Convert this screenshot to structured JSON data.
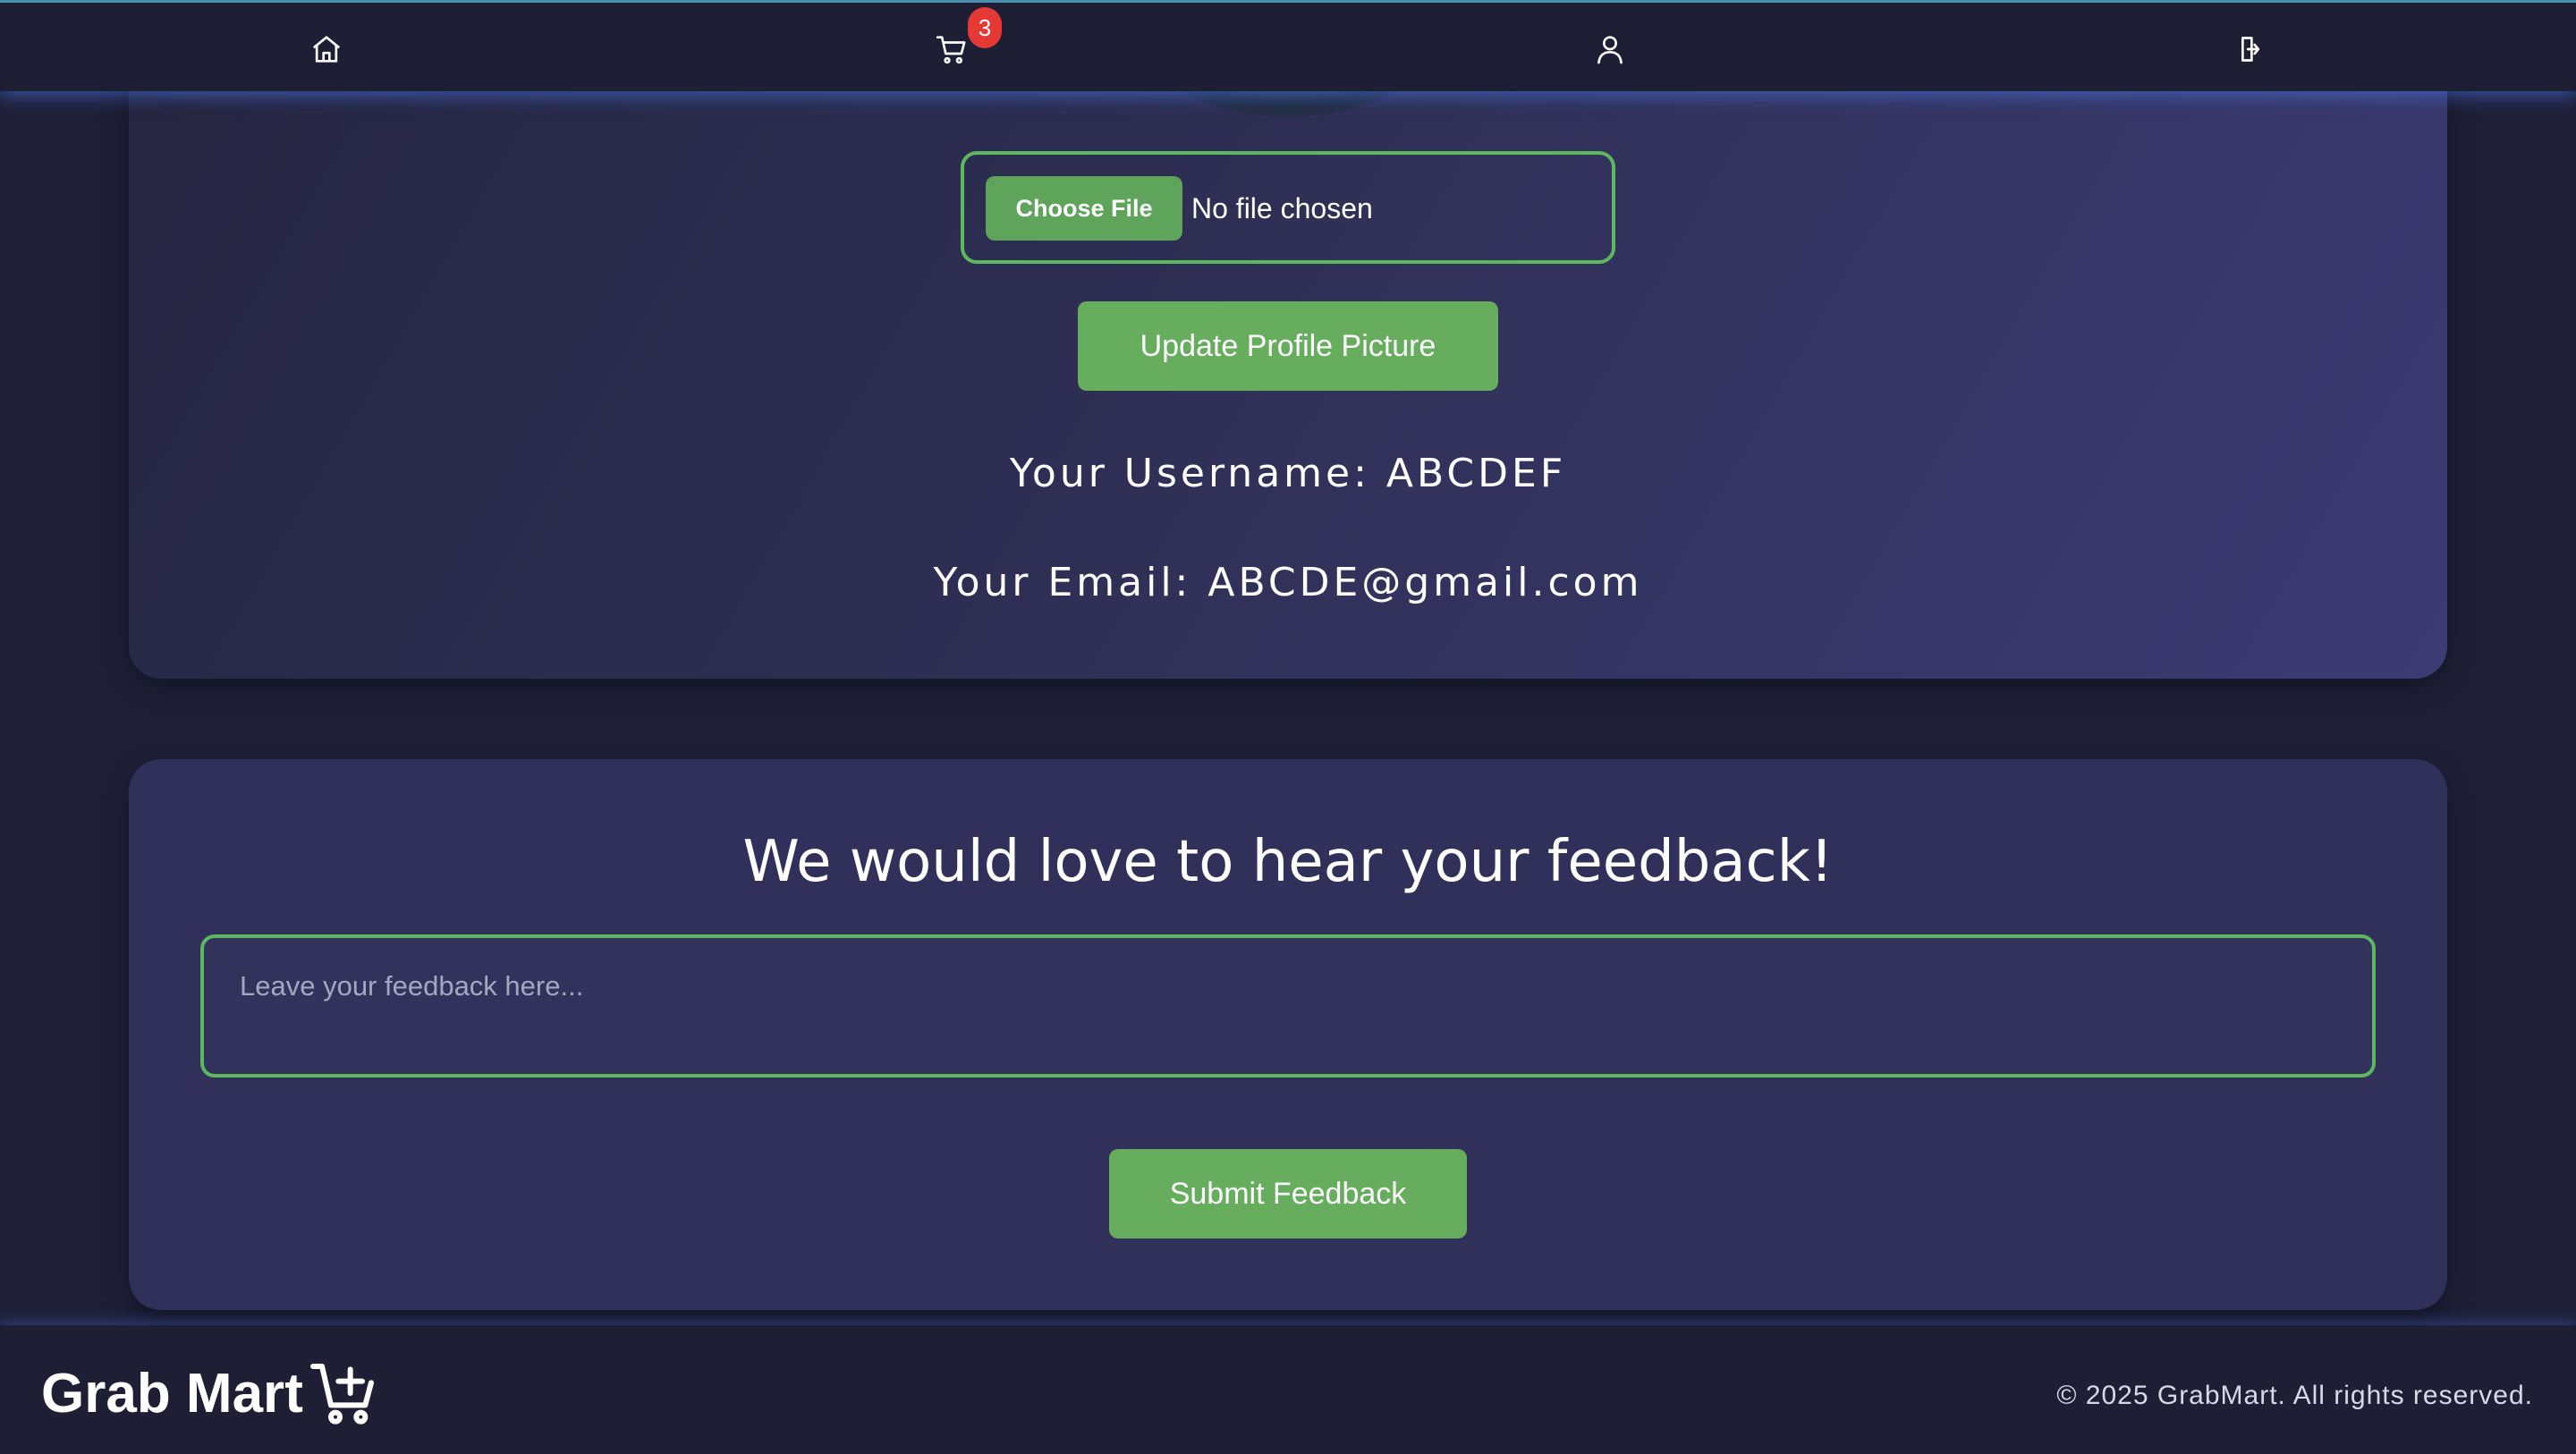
{
  "navbar": {
    "items": [
      {
        "icon": "home-icon"
      },
      {
        "icon": "cart-icon"
      },
      {
        "icon": "user-icon"
      },
      {
        "icon": "logout-icon"
      }
    ],
    "cart_count": "3"
  },
  "profile": {
    "choose_file_label": "Choose File",
    "file_status": "No file chosen",
    "update_button": "Update Profile Picture",
    "username_line": "Your Username: ABCDEF",
    "email_line": "Your Email: ABCDE@gmail.com"
  },
  "feedback": {
    "title": "We would love to hear your feedback!",
    "placeholder": "Leave your feedback here...",
    "submit_button": "Submit Feedback"
  },
  "footer": {
    "brand": "Grab Mart",
    "brand_icon": "cart-plus-icon",
    "copyright": "© 2025 GrabMart. All rights reserved."
  },
  "colors": {
    "accent_green": "#66ad5e",
    "badge_red": "#e53935",
    "background": "#1f1f38"
  }
}
